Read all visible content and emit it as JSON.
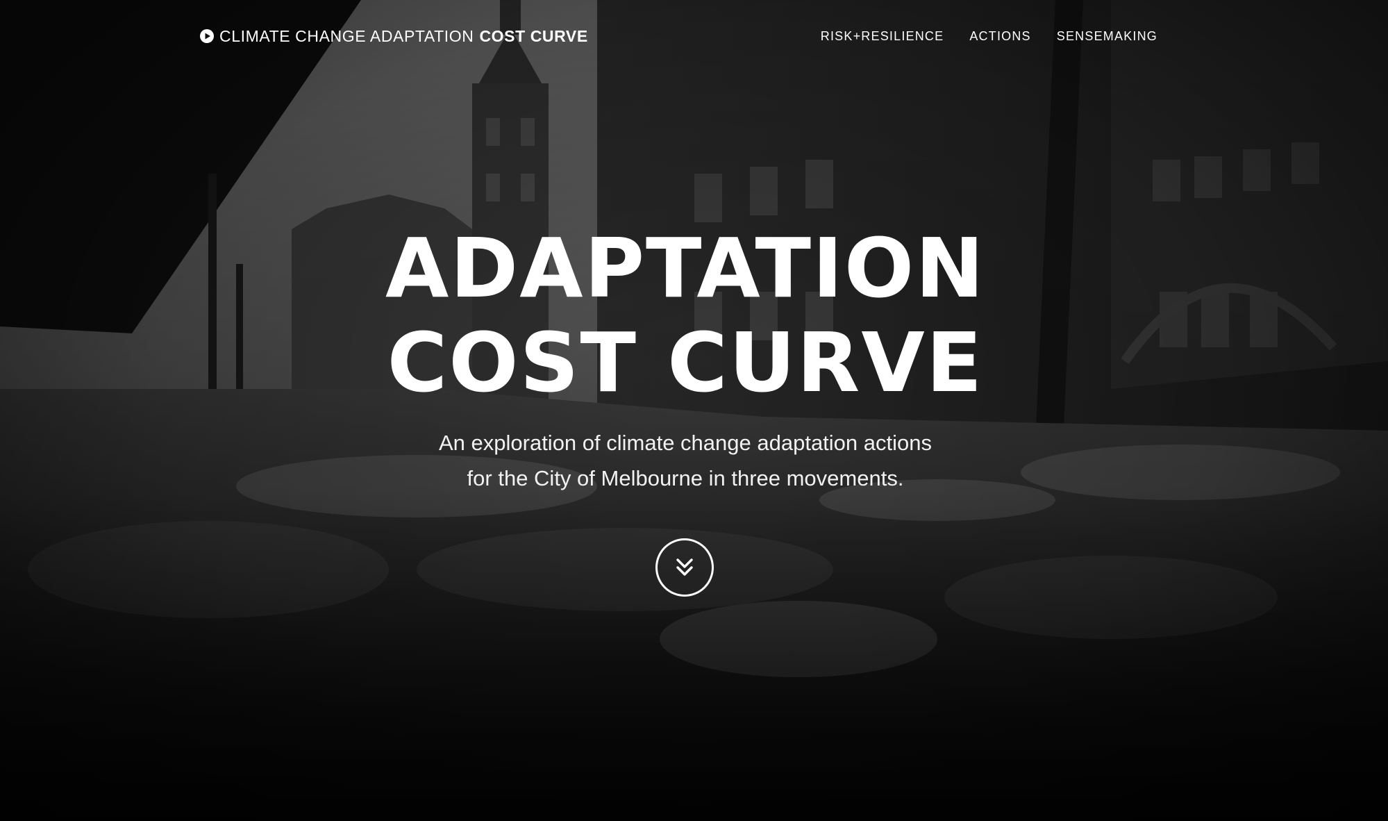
{
  "brand": {
    "light_text": "CLIMATE CHANGE ADAPTATION",
    "bold_text": "COST CURVE",
    "icon": "play-circle-icon"
  },
  "nav": {
    "items": [
      {
        "label": "RISK+RESILIENCE"
      },
      {
        "label": "ACTIONS"
      },
      {
        "label": "SENSEMAKING"
      }
    ]
  },
  "hero": {
    "title_line1": "ADAPTATION",
    "title_line2": "COST CURVE",
    "subtitle_line1": "An exploration of climate change adaptation actions",
    "subtitle_line2": "for the City of Melbourne in three movements.",
    "scroll_icon": "double-chevron-down-icon",
    "background": "black-and-white photo of a flooded Melbourne street with historic buildings"
  },
  "colors": {
    "text": "#ffffff",
    "background": "#0c0c0c"
  }
}
